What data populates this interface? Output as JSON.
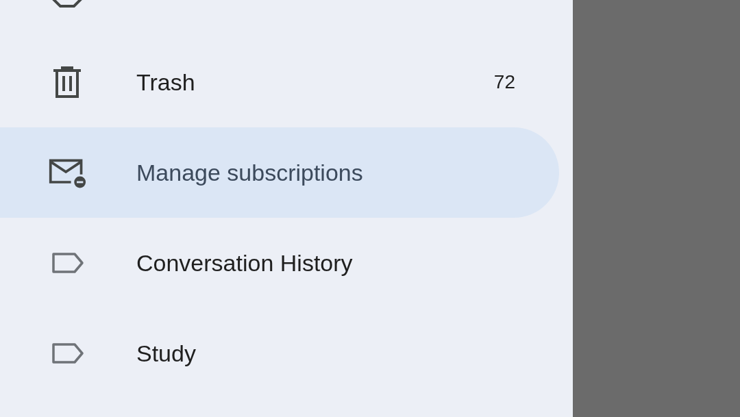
{
  "drawer": {
    "items": [
      {
        "kind": "spam",
        "selected": false
      },
      {
        "kind": "trash",
        "label": "Trash",
        "count": "72",
        "selected": false
      },
      {
        "kind": "unsubscribe",
        "label": "Manage subscriptions",
        "selected": true
      },
      {
        "kind": "label",
        "label": "Conversation History",
        "selected": false
      },
      {
        "kind": "label",
        "label": "Study",
        "selected": false
      }
    ]
  }
}
